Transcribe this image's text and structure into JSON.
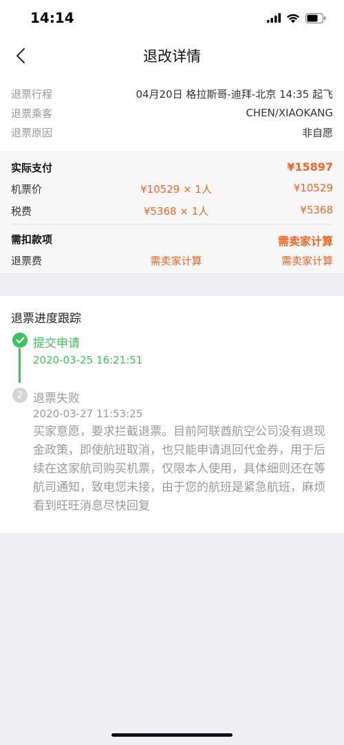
{
  "status_bar": {
    "time": "14:14"
  },
  "nav": {
    "title": "退改详情"
  },
  "info": [
    {
      "label": "退票行程",
      "value": "04月20日 格拉斯哥-迪拜-北京 14:35 起飞"
    },
    {
      "label": "退票乘客",
      "value": "CHEN/XIAOKANG"
    },
    {
      "label": "退票原因",
      "value": "非自愿"
    }
  ],
  "payment": {
    "header": {
      "label": "实际支付",
      "total": "¥15897"
    },
    "rows": [
      {
        "label": "机票价",
        "calc": "¥10529 × 1人",
        "amount": "¥10529"
      },
      {
        "label": "税费",
        "calc": "¥5368 × 1人",
        "amount": "¥5368"
      }
    ]
  },
  "deductions": {
    "header": {
      "label": "需扣款项",
      "total": "需卖家计算"
    },
    "rows": [
      {
        "label": "退票费",
        "calc": "需卖家计算",
        "amount": "需卖家计算"
      }
    ]
  },
  "progress": {
    "title": "退票进度跟踪",
    "steps": [
      {
        "index": "1",
        "name": "提交申请",
        "time": "2020-03-25 16:21:51",
        "state": "done"
      },
      {
        "index": "2",
        "name": "退票失败",
        "time": "2020-03-27 11:53:25",
        "state": "failed",
        "desc": "买家意愿，要求拦截退票。目前阿联酋航空公司没有退现金政策，即使航班取消，也只能申请退回代金券，用于后续在这家航司购买机票，仅限本人使用，具体细则还在等航司通知，致电您未接，由于您的航班是紧急航班，麻烦看到旺旺消息尽快回复"
      }
    ]
  },
  "colors": {
    "accent": "#f26522",
    "success": "#3cc35a",
    "muted": "#999999"
  },
  "icons": {
    "back": "chevron-left-icon",
    "done": "check-icon"
  }
}
